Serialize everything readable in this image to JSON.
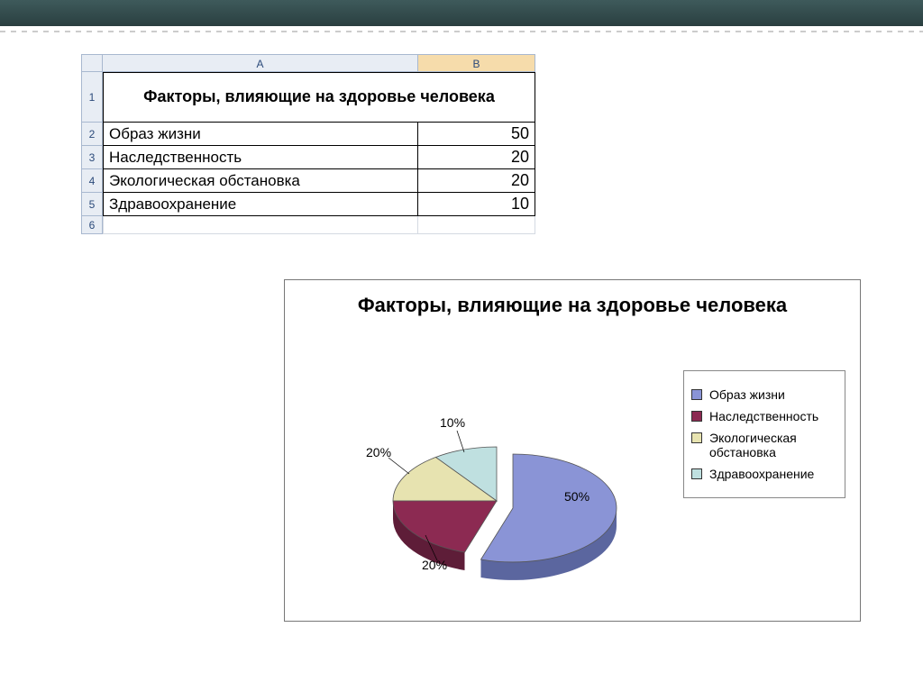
{
  "spreadsheet": {
    "columns": {
      "A": "A",
      "B": "B"
    },
    "row_numbers": [
      "1",
      "2",
      "3",
      "4",
      "5",
      "6"
    ],
    "title": "Факторы, влияющие на здоровье человека",
    "rows": [
      {
        "label": "Образ жизни",
        "value": "50"
      },
      {
        "label": "Наследственность",
        "value": "20"
      },
      {
        "label": "Экологическая обстановка",
        "value": "20"
      },
      {
        "label": "Здравоохранение",
        "value": "10"
      }
    ]
  },
  "chart": {
    "title": "Факторы, влияющие на здоровье человека",
    "legend": [
      "Образ жизни",
      "Наследственность",
      "Экологическая обстановка",
      "Здравоохранение"
    ],
    "data_labels": [
      "50%",
      "20%",
      "20%",
      "10%"
    ],
    "colors": {
      "series1": "#8a94d6",
      "series2": "#8c2a52",
      "series3": "#e7e3b0",
      "series4": "#bfe0e0"
    }
  },
  "chart_data": {
    "type": "pie",
    "title": "Факторы, влияющие на здоровье человека",
    "categories": [
      "Образ жизни",
      "Наследственность",
      "Экологическая обстановка",
      "Здравоохранение"
    ],
    "values": [
      50,
      20,
      20,
      10
    ],
    "series": [
      {
        "name": "Образ жизни",
        "value": 50,
        "color": "#8a94d6"
      },
      {
        "name": "Наследственность",
        "value": 20,
        "color": "#8c2a52"
      },
      {
        "name": "Экологическая обстановка",
        "value": 20,
        "color": "#e7e3b0"
      },
      {
        "name": "Здравоохранение",
        "value": 10,
        "color": "#bfe0e0"
      }
    ],
    "exploded_slice_index": 0,
    "is_3d": true,
    "data_labels_visible": true
  }
}
